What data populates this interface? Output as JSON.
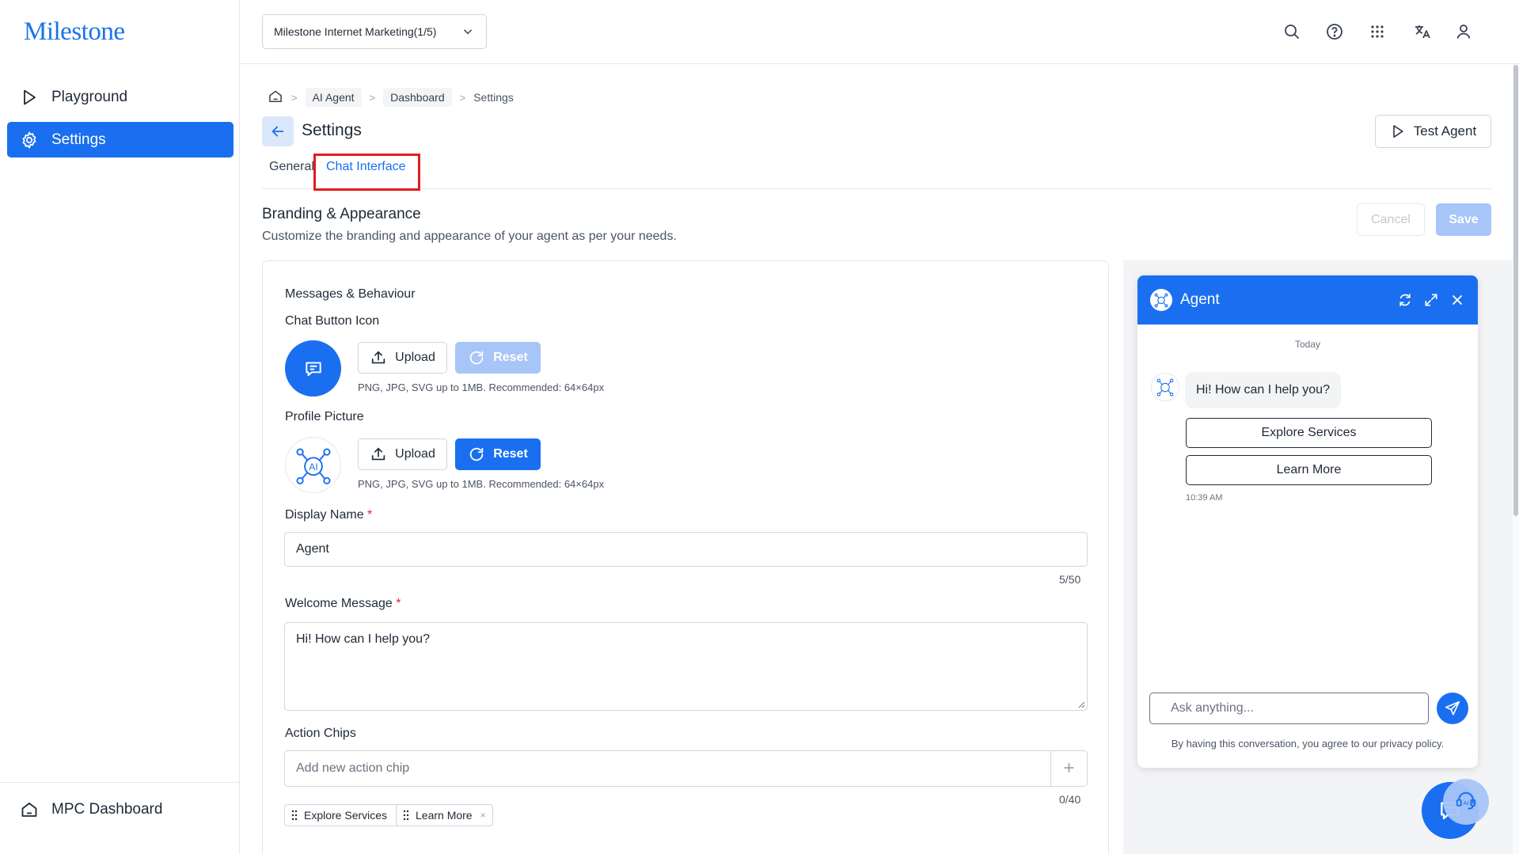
{
  "sidebar": {
    "logo": "Milestone",
    "items": [
      {
        "label": "Playground",
        "icon": "play-icon"
      },
      {
        "label": "Settings",
        "icon": "gear-icon"
      }
    ],
    "bottom_item": {
      "label": "MPC Dashboard",
      "icon": "home-icon"
    }
  },
  "topbar": {
    "org_select": "Milestone Internet Marketing(1/5)",
    "icons": [
      "search-icon",
      "help-icon",
      "apps-grid-icon",
      "translate-icon",
      "user-icon"
    ]
  },
  "breadcrumb": {
    "items": [
      "AI Agent",
      "Dashboard"
    ],
    "current": "Settings"
  },
  "page": {
    "title": "Settings",
    "test_agent": "Test Agent"
  },
  "tabs": [
    {
      "label": "General"
    },
    {
      "label": "Chat Interface",
      "active": true
    }
  ],
  "section": {
    "title": "Branding & Appearance",
    "subtitle": "Customize the branding and appearance of your agent as per your needs.",
    "cancel": "Cancel",
    "save": "Save"
  },
  "form": {
    "group_title": "Messages & Behaviour",
    "chat_button_icon": {
      "label": "Chat Button Icon",
      "upload": "Upload",
      "reset": "Reset",
      "hint": "PNG, JPG, SVG up to 1MB. Recommended: 64×64px"
    },
    "profile_picture": {
      "label": "Profile Picture",
      "upload": "Upload",
      "reset": "Reset",
      "hint": "PNG, JPG, SVG up to 1MB. Recommended: 64×64px"
    },
    "display_name": {
      "label": "Display Name",
      "required": "*",
      "value": "Agent",
      "counter": "5/50"
    },
    "welcome_message": {
      "label": "Welcome Message",
      "required": "*",
      "value": "Hi! How can I help you?"
    },
    "action_chips": {
      "label": "Action Chips",
      "placeholder": "Add new action chip",
      "add": "+",
      "counter": "0/40",
      "chips": [
        "Explore Services",
        "Learn More"
      ],
      "remove": "×"
    }
  },
  "preview": {
    "header_name": "Agent",
    "today": "Today",
    "welcome": "Hi! How can I help you?",
    "chips": [
      "Explore Services",
      "Learn More"
    ],
    "time": "10:39 AM",
    "input_placeholder": "Ask anything...",
    "privacy": "By having this conversation, you agree to our privacy policy."
  },
  "colors": {
    "accent": "#1a6ff0",
    "accent_light": "#a8c5f8",
    "highlight_box": "#e11d1d"
  }
}
